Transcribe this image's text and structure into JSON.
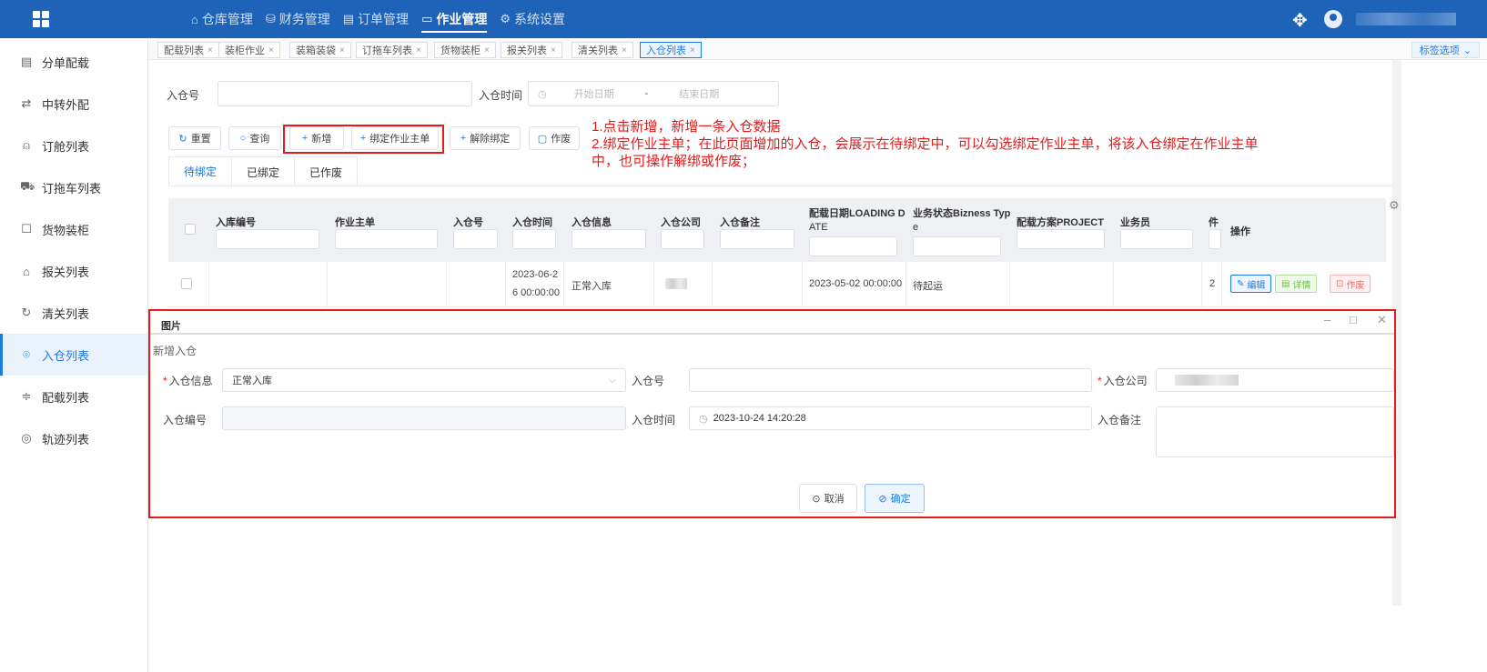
{
  "header": {
    "nav": [
      {
        "icon": "home-icon",
        "label": "仓库管理"
      },
      {
        "icon": "database-icon",
        "label": "财务管理"
      },
      {
        "icon": "document-icon",
        "label": "订单管理"
      },
      {
        "icon": "folder-icon",
        "label": "作业管理"
      },
      {
        "icon": "gear-icon",
        "label": "系统设置"
      }
    ],
    "active_nav": "作业管理"
  },
  "sidebar": {
    "items": [
      {
        "icon": "list-icon",
        "label": "分单配载"
      },
      {
        "icon": "transfer-icon",
        "label": "中转外配"
      },
      {
        "icon": "ship-icon",
        "label": "订舱列表"
      },
      {
        "icon": "truck-icon",
        "label": "订拖车列表"
      },
      {
        "icon": "container-icon",
        "label": "货物装柜"
      },
      {
        "icon": "customs-icon",
        "label": "报关列表"
      },
      {
        "icon": "clearance-icon",
        "label": "清关列表"
      },
      {
        "icon": "warehouse-icon",
        "label": "入仓列表"
      },
      {
        "icon": "sliders-icon",
        "label": "配载列表"
      },
      {
        "icon": "location-icon",
        "label": "轨迹列表"
      }
    ],
    "active": "入仓列表"
  },
  "tabs": {
    "items": [
      "配载列表",
      "装柜作业",
      "装箱装袋",
      "订拖车列表",
      "货物装柜",
      "报关列表",
      "清关列表",
      "入仓列表"
    ],
    "active": "入仓列表",
    "options_label": "标签选项"
  },
  "search": {
    "inbound_no_label": "入仓号",
    "inbound_time_label": "入仓时间",
    "start_placeholder": "开始日期",
    "separator": "-",
    "end_placeholder": "结束日期"
  },
  "toolbar": {
    "reset": "重置",
    "query": "查询",
    "add": "新增",
    "bind": "绑定作业主单",
    "unbind": "解除绑定",
    "void": "作废"
  },
  "annotation": {
    "line1": "1.点击新增，新增一条入仓数据",
    "line2": "2.绑定作业主单；在此页面增加的入仓，会展示在待绑定中，可以勾选绑定作业主单，将该入仓绑定在作业主单",
    "line3": "中，也可操作解绑或作废；"
  },
  "subtabs": [
    "待绑定",
    "已绑定",
    "已作废"
  ],
  "table": {
    "columns": [
      {
        "line1": "入库编号",
        "line2": ""
      },
      {
        "line1": "作业主单",
        "line2": ""
      },
      {
        "line1": "入仓号",
        "line2": ""
      },
      {
        "line1": "入仓时间",
        "line2": ""
      },
      {
        "line1": "入仓信息",
        "line2": ""
      },
      {
        "line1": "入仓公司",
        "line2": ""
      },
      {
        "line1": "入仓备注",
        "line2": ""
      },
      {
        "line1": "配载日期LOADING D",
        "line2": "ATE"
      },
      {
        "line1": "业务状态Bizness Typ",
        "line2": "e"
      },
      {
        "line1": "配载方案PROJECT",
        "line2": ""
      },
      {
        "line1": "业务员",
        "line2": ""
      },
      {
        "line1": "件",
        "line2": ""
      },
      {
        "line1": "操作",
        "line2": ""
      }
    ],
    "row": {
      "time_line1": "2023-06-2",
      "time_line2": "6 00:00:00",
      "info": "正常入库",
      "loading_date": "2023-05-02 00:00:00",
      "status": "待起运",
      "pieces": "2",
      "edit": "编辑",
      "detail": "详情",
      "void": "作废"
    }
  },
  "modal": {
    "title": "图片",
    "subtitle": "新增入仓",
    "fields": {
      "info_label": "入仓信息",
      "info_value": "正常入库",
      "no_label": "入仓号",
      "company_label": "入仓公司",
      "code_label": "入仓编号",
      "time_label": "入仓时间",
      "time_value": "2023-10-24 14:20:28",
      "remark_label": "入仓备注"
    },
    "cancel": "取消",
    "confirm": "确定"
  },
  "colors": {
    "header_bg": "#1f63b8",
    "accent": "#1f7ae0",
    "annotation_red": "#e31b1b"
  }
}
